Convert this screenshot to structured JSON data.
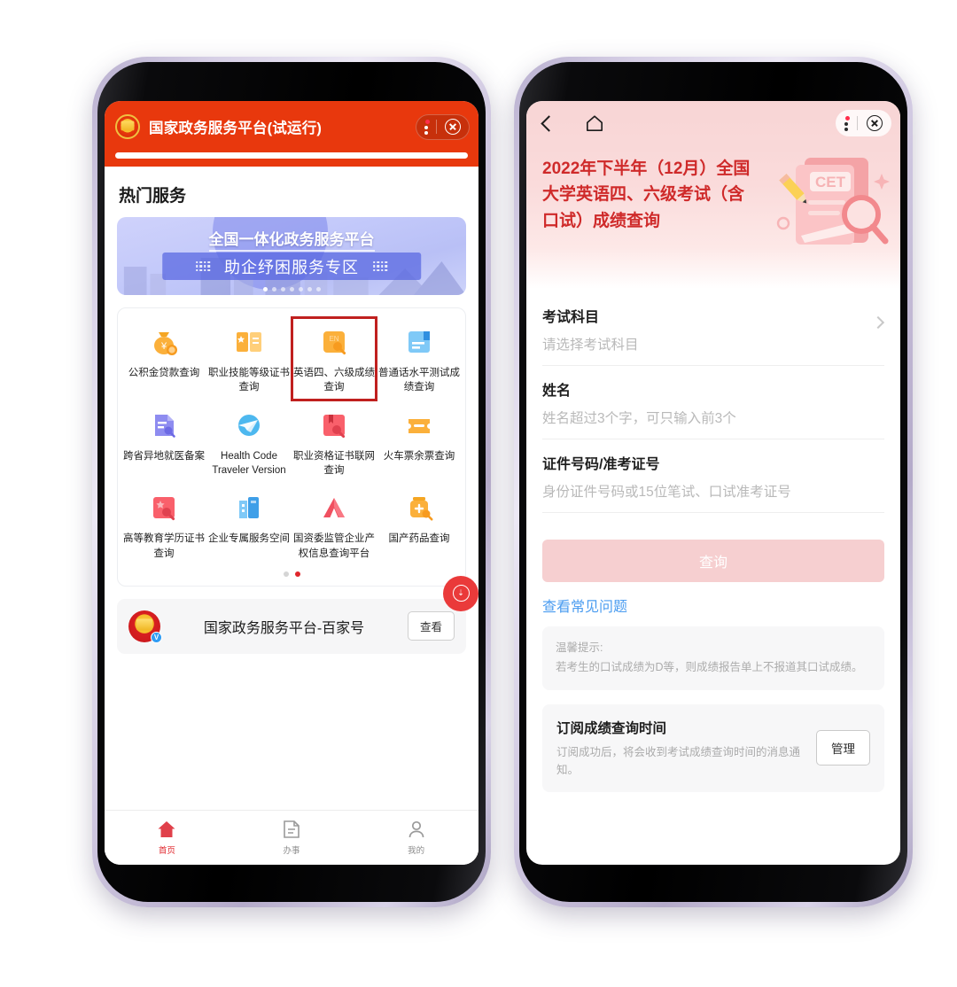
{
  "left_phone": {
    "header": {
      "title": "国家政务服务平台(试运行)",
      "emblem_icon": "national-emblem-icon",
      "more_icon": "three-dots-icon",
      "close_icon": "close-circle-icon",
      "accent_color": "#e8380d"
    },
    "section_title": "热门服务",
    "banner": {
      "line1": "全国一体化政务服务平台",
      "line2": "助企纾困服务专区",
      "dot_count": 7,
      "active_dot": 0
    },
    "services": [
      {
        "label": "公积金贷款查询",
        "icon": "money-bag-icon",
        "highlighted": false
      },
      {
        "label": "职业技能等级证书查询",
        "icon": "certificate-book-icon",
        "highlighted": false
      },
      {
        "label": "英语四、六级成绩查询",
        "icon": "english-exam-icon",
        "highlighted": true
      },
      {
        "label": "普通话水平测试成绩查询",
        "icon": "blue-document-icon",
        "highlighted": false
      },
      {
        "label": "跨省异地就医备案",
        "icon": "purple-record-icon",
        "highlighted": false
      },
      {
        "label": "Health Code Traveler Version",
        "icon": "plane-health-code-icon",
        "highlighted": false
      },
      {
        "label": "职业资格证书联网查询",
        "icon": "red-book-search-icon",
        "highlighted": false
      },
      {
        "label": "火车票余票查询",
        "icon": "ticket-icon",
        "highlighted": false
      },
      {
        "label": "高等教育学历证书查询",
        "icon": "diploma-search-icon",
        "highlighted": false
      },
      {
        "label": "企业专属服务空间",
        "icon": "building-icon",
        "highlighted": false
      },
      {
        "label": "国资委监管企业产权信息查询平台",
        "icon": "red-arch-icon",
        "highlighted": false
      },
      {
        "label": "国产药品查询",
        "icon": "medicine-bottle-icon",
        "highlighted": false
      }
    ],
    "pager": {
      "count": 2,
      "active": 1
    },
    "account_card": {
      "name": "国家政务服务平台-百家号",
      "button": "查看",
      "avatar_icon": "national-emblem-avatar",
      "verified_badge": "V",
      "float_badge_icon": "download-badge-icon"
    },
    "tabbar": [
      {
        "label": "首页",
        "icon": "home-icon",
        "active": true
      },
      {
        "label": "办事",
        "icon": "document-icon",
        "active": false
      },
      {
        "label": "我的",
        "icon": "person-icon",
        "active": false
      }
    ]
  },
  "right_phone": {
    "nav": {
      "back_icon": "chevron-left-icon",
      "home_icon": "home-outline-icon",
      "more_icon": "three-dots-icon",
      "close_icon": "close-circle-icon"
    },
    "title": "2022年下半年（12月）全国大学英语四、六级考试（含口试）成绩查询",
    "title_color": "#cf2a2a",
    "illustration": {
      "name": "cet-exam-illustration",
      "text": "CET"
    },
    "form": [
      {
        "label": "考试科目",
        "value": "请选择考试科目",
        "type": "select",
        "has_chevron": true
      },
      {
        "label": "姓名",
        "value": "姓名超过3个字，可只输入前3个",
        "type": "text",
        "has_chevron": false
      },
      {
        "label": "证件号码/准考证号",
        "value": "身份证件号码或15位笔试、口试准考证号",
        "type": "text",
        "has_chevron": false
      }
    ],
    "submit_button": "查询",
    "faq_link": "查看常见问题",
    "tip": {
      "title": "温馨提示:",
      "body": "若考生的口试成绩为D等，则成绩报告单上不报道其口试成绩。"
    },
    "subscribe_card": {
      "title": "订阅成绩查询时间",
      "desc": "订阅成功后，将会收到考试成绩查询时间的消息通知。",
      "button": "管理"
    }
  }
}
